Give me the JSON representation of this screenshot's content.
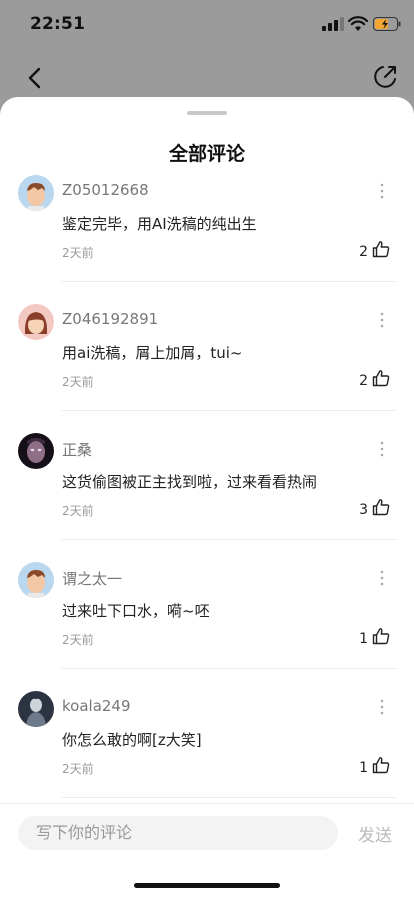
{
  "status_bar": {
    "time": "22:51"
  },
  "nav": {
    "back_icon": "chevron-left-icon",
    "share_icon": "share-arrow-icon"
  },
  "sheet": {
    "title": "全部评论"
  },
  "comments": [
    {
      "username": "Z05012668",
      "text": "鉴定完毕，用AI洗稿的纯出生",
      "time": "2天前",
      "likes": "2",
      "avatar": "cartoon-boy-avatar"
    },
    {
      "username": "Z046192891",
      "text": "用ai洗稿，屑上加屑，tui~",
      "time": "2天前",
      "likes": "2",
      "avatar": "cartoon-girl-avatar"
    },
    {
      "username": "正桑",
      "text": "这货偷图被正主找到啦，过来看看热闹",
      "time": "2天前",
      "likes": "3",
      "avatar": "dark-portrait-avatar"
    },
    {
      "username": "谓之太一",
      "text": "过来吐下口水，嗬~呸",
      "time": "2天前",
      "likes": "1",
      "avatar": "cartoon-boy-avatar"
    },
    {
      "username": "koala249",
      "text": "你怎么敢的啊[z大笑]",
      "time": "2天前",
      "likes": "1",
      "avatar": "anime-figure-avatar"
    }
  ],
  "bottom_bar": {
    "input_placeholder": "写下你的评论",
    "send_label": "发送"
  },
  "colors": {
    "overlay": "#9b9b9b",
    "sheet": "#ffffff",
    "muted_text": "#9a9a9a",
    "send_disabled": "#bbbbbb"
  }
}
